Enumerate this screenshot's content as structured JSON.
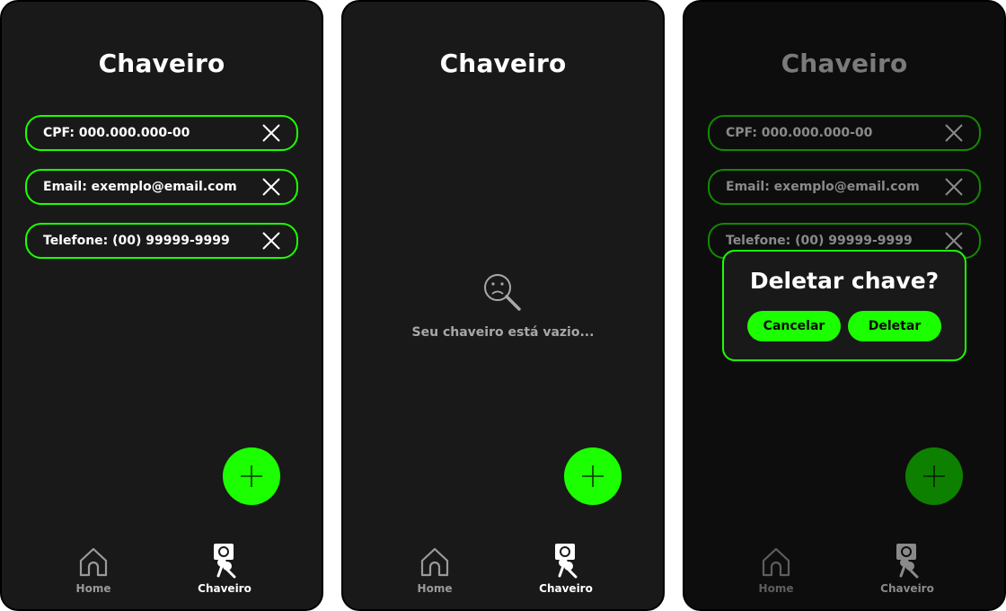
{
  "screens": [
    {
      "title": "Chaveiro",
      "keys": [
        "CPF: 000.000.000-00",
        "Email: exemplo@email.com",
        "Telefone: (00) 99999-9999"
      ],
      "nav": {
        "home": "Home",
        "chaveiro": "Chaveiro"
      }
    },
    {
      "title": "Chaveiro",
      "empty_message": "Seu chaveiro está vazio...",
      "nav": {
        "home": "Home",
        "chaveiro": "Chaveiro"
      }
    },
    {
      "title": "Chaveiro",
      "keys": [
        "CPF: 000.000.000-00",
        "Email: exemplo@email.com",
        "Telefone: (00) 99999-9999"
      ],
      "dialog": {
        "title": "Deletar chave?",
        "cancel_label": "Cancelar",
        "confirm_label": "Deletar"
      },
      "nav": {
        "home": "Home",
        "chaveiro": "Chaveiro"
      }
    }
  ],
  "colors": {
    "accent": "#1cff00",
    "background": "#191919",
    "dim_accent": "#0e8000"
  },
  "icons": {
    "remove": "close-icon",
    "add": "plus-icon",
    "empty": "search-sad-icon",
    "home": "home-icon",
    "chaveiro": "keychain-icon"
  }
}
